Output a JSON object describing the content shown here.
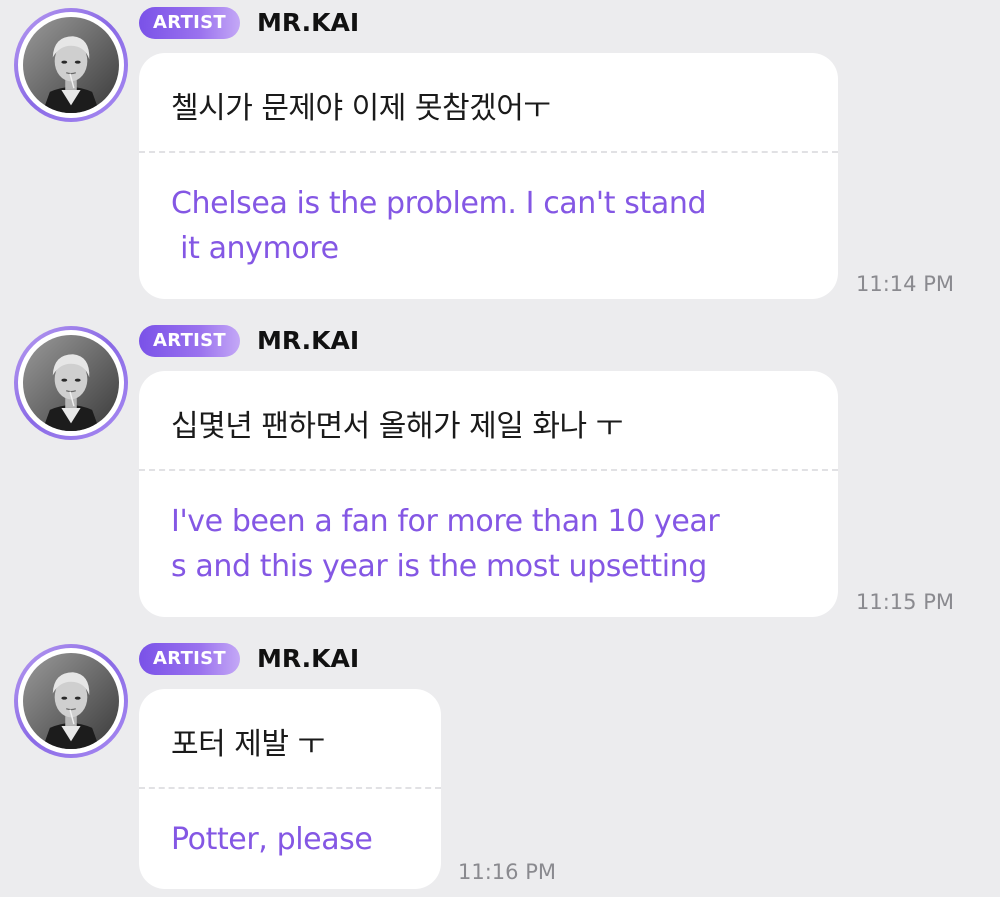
{
  "messages": [
    {
      "badge": "ARTIST",
      "name": "MR.KAI",
      "original": "첼시가 문제야 이제 못참겠어ㅜ",
      "translation": "Chelsea is the problem. I can't stand\n it anymore",
      "time": "11:14 PM"
    },
    {
      "badge": "ARTIST",
      "name": "MR.KAI",
      "original": "십몇년 팬하면서 올해가 제일 화나 ㅜ",
      "translation": "I've been a fan for more than 10 year\ns and this year is the most upsetting",
      "time": "11:15 PM"
    },
    {
      "badge": "ARTIST",
      "name": "MR.KAI",
      "original": "포터 제발 ㅜ",
      "translation": "Potter, please",
      "time": "11:16 PM"
    }
  ],
  "colors": {
    "background": "#ececee",
    "bubble": "#ffffff",
    "translation_text": "#8457e4",
    "badge_gradient_start": "#7a52e8",
    "badge_gradient_end": "#c4a8f6",
    "timestamp": "#8a8a8f"
  },
  "icons": {
    "avatar": "artist-profile-photo"
  }
}
